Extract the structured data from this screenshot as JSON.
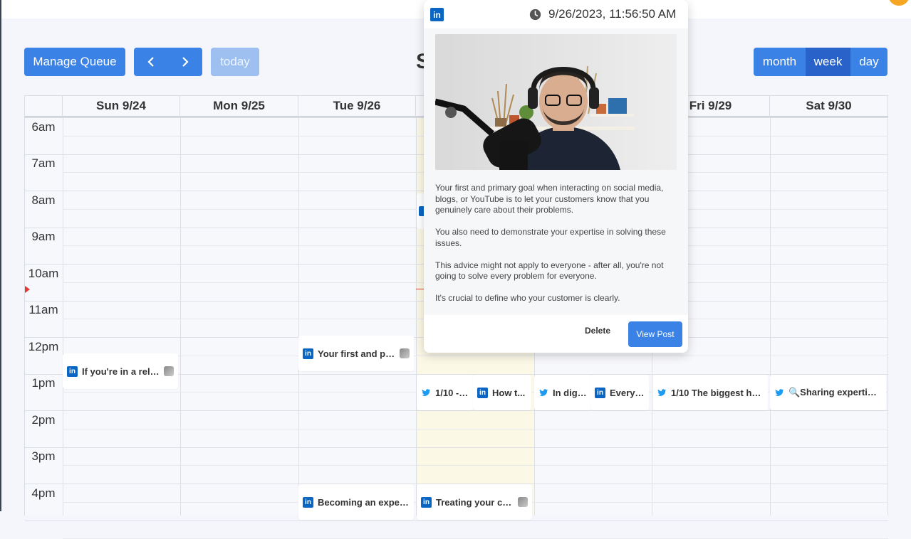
{
  "toolbar": {
    "manage_queue_label": "Manage Queue",
    "prev_label": "‹",
    "next_label": "›",
    "today_label": "today",
    "title_fragment": "S",
    "views": [
      "month",
      "week",
      "day"
    ],
    "active_view": "week"
  },
  "calendar": {
    "columns": [
      "Sun 9/24",
      "Mon 9/25",
      "Tue 9/26",
      "",
      "",
      "Fri 9/29",
      "Sat 9/30"
    ],
    "times": [
      "6am",
      "7am",
      "8am",
      "9am",
      "10am",
      "11am",
      "12pm",
      "1pm",
      "2pm",
      "3pm",
      "4pm"
    ],
    "events": {
      "sun_noon": "If you're in a relat...",
      "tue_noon": "Your first and pri...",
      "wed_1pm_a": "1/10 - I...",
      "wed_1pm_b": "How t...",
      "thu_1pm_a": "In digi...",
      "thu_1pm_b": "Every ...",
      "fri_1pm": "1/10 The biggest hu...",
      "sat_1pm": "🔍Sharing expertise...",
      "tue_4pm": "Becoming an exper...",
      "wed_4pm": "Treating your ca..."
    }
  },
  "popup": {
    "network_icon_text": "in",
    "datetime": "9/26/2023, 11:56:50 AM",
    "paragraphs": [
      "Your first and primary goal when interacting on social media, blogs, or YouTube is to let your customers know that you genuinely care about their problems.",
      "You also need to demonstrate your expertise in solving these issues.",
      "This advice might not apply to everyone - after all, you're not going to solve every problem for everyone.",
      "It's crucial to define who your customer is clearly."
    ],
    "delete_label": "Delete",
    "view_label": "View Post"
  },
  "colors": {
    "primary": "#3b82e6",
    "primary_active": "#2962c8",
    "linkedin": "#0a66c2",
    "twitter": "#1d9bf0",
    "now_indicator": "#e53935",
    "today_highlight": "#fbf8e6"
  }
}
